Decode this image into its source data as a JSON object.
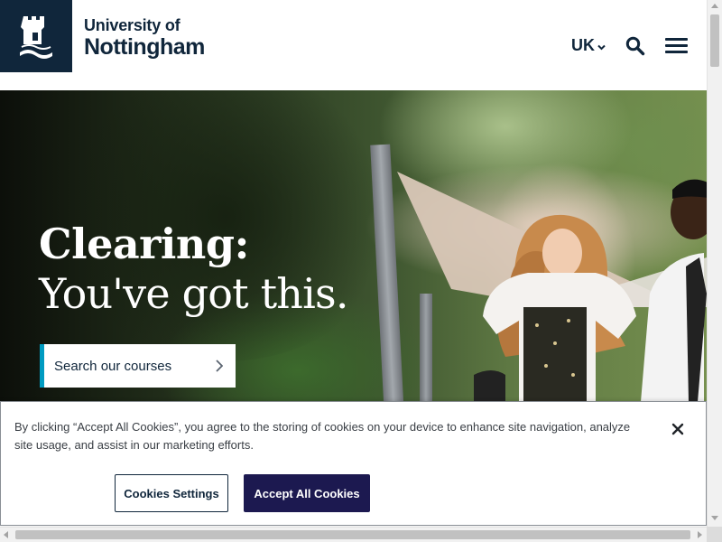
{
  "header": {
    "brand_line1": "University of",
    "brand_line2": "Nottingham",
    "region_label": "UK",
    "logo_icon": "castle-crest-icon",
    "search_icon": "search-icon",
    "menu_icon": "hamburger-menu-icon",
    "colors": {
      "brand_navy": "#10263b"
    }
  },
  "hero": {
    "title_line1": "Clearing:",
    "title_line2": "You've got this.",
    "cta_label": "Search our courses",
    "cta_icon": "chevron-right-icon",
    "colors": {
      "cta_accent": "#009bc1"
    }
  },
  "cookie_banner": {
    "text": "By clicking “Accept All Cookies”, you agree to the storing of cookies on your device to enhance site navigation, analyze site usage, and assist in our marketing efforts.",
    "settings_label": "Cookies Settings",
    "accept_label": "Accept All Cookies",
    "close_icon": "close-icon",
    "colors": {
      "accept_bg": "#1c1950"
    }
  }
}
